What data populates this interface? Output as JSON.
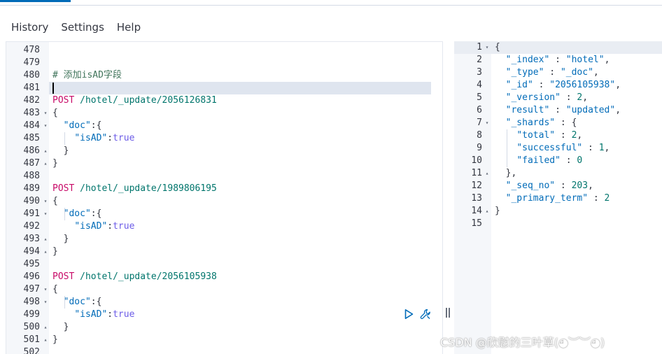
{
  "menu": {
    "items": [
      "History",
      "Settings",
      "Help"
    ]
  },
  "request_editor": {
    "lines": [
      {
        "num": "478",
        "fold": "",
        "tokens": []
      },
      {
        "num": "479",
        "fold": "",
        "tokens": []
      },
      {
        "num": "480",
        "fold": "",
        "tokens": [
          {
            "t": "comment",
            "v": "# 添加isAD字段"
          }
        ]
      },
      {
        "num": "481",
        "fold": "",
        "tokens": [],
        "active": true
      },
      {
        "num": "482",
        "fold": "",
        "tokens": [
          {
            "t": "method",
            "v": "POST"
          },
          {
            "t": "punc",
            "v": " "
          },
          {
            "t": "url",
            "v": "/hotel/_update/2056126831"
          }
        ]
      },
      {
        "num": "483",
        "fold": "▾",
        "tokens": [
          {
            "t": "punc",
            "v": "{"
          }
        ]
      },
      {
        "num": "484",
        "fold": "▾",
        "tokens": [
          {
            "t": "punc",
            "v": "  "
          },
          {
            "t": "key",
            "v": "\"doc\""
          },
          {
            "t": "punc",
            "v": ":{"
          }
        ]
      },
      {
        "num": "485",
        "fold": "",
        "tokens": [
          {
            "t": "punc",
            "v": "    "
          },
          {
            "t": "key",
            "v": "\"isAD\""
          },
          {
            "t": "punc",
            "v": ":"
          },
          {
            "t": "bool",
            "v": "true"
          }
        ]
      },
      {
        "num": "486",
        "fold": "▴",
        "tokens": [
          {
            "t": "punc",
            "v": "  }"
          }
        ]
      },
      {
        "num": "487",
        "fold": "▴",
        "tokens": [
          {
            "t": "punc",
            "v": "}"
          }
        ]
      },
      {
        "num": "488",
        "fold": "",
        "tokens": []
      },
      {
        "num": "489",
        "fold": "",
        "tokens": [
          {
            "t": "method",
            "v": "POST"
          },
          {
            "t": "punc",
            "v": " "
          },
          {
            "t": "url",
            "v": "/hotel/_update/1989806195"
          }
        ]
      },
      {
        "num": "490",
        "fold": "▾",
        "tokens": [
          {
            "t": "punc",
            "v": "{"
          }
        ]
      },
      {
        "num": "491",
        "fold": "▾",
        "tokens": [
          {
            "t": "punc",
            "v": "  "
          },
          {
            "t": "key",
            "v": "\"doc\""
          },
          {
            "t": "punc",
            "v": ":{"
          }
        ]
      },
      {
        "num": "492",
        "fold": "",
        "tokens": [
          {
            "t": "punc",
            "v": "    "
          },
          {
            "t": "key",
            "v": "\"isAD\""
          },
          {
            "t": "punc",
            "v": ":"
          },
          {
            "t": "bool",
            "v": "true"
          }
        ]
      },
      {
        "num": "493",
        "fold": "▴",
        "tokens": [
          {
            "t": "punc",
            "v": "  }"
          }
        ]
      },
      {
        "num": "494",
        "fold": "▴",
        "tokens": [
          {
            "t": "punc",
            "v": "}"
          }
        ]
      },
      {
        "num": "495",
        "fold": "",
        "tokens": []
      },
      {
        "num": "496",
        "fold": "",
        "tokens": [
          {
            "t": "method",
            "v": "POST"
          },
          {
            "t": "punc",
            "v": " "
          },
          {
            "t": "url",
            "v": "/hotel/_update/2056105938"
          }
        ]
      },
      {
        "num": "497",
        "fold": "▾",
        "tokens": [
          {
            "t": "punc",
            "v": "{"
          }
        ]
      },
      {
        "num": "498",
        "fold": "▾",
        "tokens": [
          {
            "t": "punc",
            "v": "  "
          },
          {
            "t": "key",
            "v": "\"doc\""
          },
          {
            "t": "punc",
            "v": ":{"
          }
        ]
      },
      {
        "num": "499",
        "fold": "",
        "tokens": [
          {
            "t": "punc",
            "v": "    "
          },
          {
            "t": "key",
            "v": "\"isAD\""
          },
          {
            "t": "punc",
            "v": ":"
          },
          {
            "t": "bool",
            "v": "true"
          }
        ]
      },
      {
        "num": "500",
        "fold": "▴",
        "tokens": [
          {
            "t": "punc",
            "v": "  }"
          }
        ]
      },
      {
        "num": "501",
        "fold": "▴",
        "tokens": [
          {
            "t": "punc",
            "v": "}"
          }
        ]
      },
      {
        "num": "502",
        "fold": "",
        "tokens": []
      }
    ]
  },
  "response_editor": {
    "lines": [
      {
        "num": "1",
        "fold": "▾",
        "tokens": [
          {
            "t": "punc",
            "v": "{"
          }
        ]
      },
      {
        "num": "2",
        "fold": "",
        "tokens": [
          {
            "t": "punc",
            "v": "  "
          },
          {
            "t": "str",
            "v": "\"_index\""
          },
          {
            "t": "punc",
            "v": " : "
          },
          {
            "t": "str",
            "v": "\"hotel\""
          },
          {
            "t": "punc",
            "v": ","
          }
        ]
      },
      {
        "num": "3",
        "fold": "",
        "tokens": [
          {
            "t": "punc",
            "v": "  "
          },
          {
            "t": "str",
            "v": "\"_type\""
          },
          {
            "t": "punc",
            "v": " : "
          },
          {
            "t": "str",
            "v": "\"_doc\""
          },
          {
            "t": "punc",
            "v": ","
          }
        ]
      },
      {
        "num": "4",
        "fold": "",
        "tokens": [
          {
            "t": "punc",
            "v": "  "
          },
          {
            "t": "str",
            "v": "\"_id\""
          },
          {
            "t": "punc",
            "v": " : "
          },
          {
            "t": "str",
            "v": "\"2056105938\""
          },
          {
            "t": "punc",
            "v": ","
          }
        ]
      },
      {
        "num": "5",
        "fold": "",
        "tokens": [
          {
            "t": "punc",
            "v": "  "
          },
          {
            "t": "str",
            "v": "\"_version\""
          },
          {
            "t": "punc",
            "v": " : "
          },
          {
            "t": "num",
            "v": "2"
          },
          {
            "t": "punc",
            "v": ","
          }
        ]
      },
      {
        "num": "6",
        "fold": "",
        "tokens": [
          {
            "t": "punc",
            "v": "  "
          },
          {
            "t": "str",
            "v": "\"result\""
          },
          {
            "t": "punc",
            "v": " : "
          },
          {
            "t": "str",
            "v": "\"updated\""
          },
          {
            "t": "punc",
            "v": ","
          }
        ]
      },
      {
        "num": "7",
        "fold": "▾",
        "tokens": [
          {
            "t": "punc",
            "v": "  "
          },
          {
            "t": "str",
            "v": "\"_shards\""
          },
          {
            "t": "punc",
            "v": " : {"
          }
        ]
      },
      {
        "num": "8",
        "fold": "",
        "tokens": [
          {
            "t": "punc",
            "v": "    "
          },
          {
            "t": "str",
            "v": "\"total\""
          },
          {
            "t": "punc",
            "v": " : "
          },
          {
            "t": "num",
            "v": "2"
          },
          {
            "t": "punc",
            "v": ","
          }
        ]
      },
      {
        "num": "9",
        "fold": "",
        "tokens": [
          {
            "t": "punc",
            "v": "    "
          },
          {
            "t": "str",
            "v": "\"successful\""
          },
          {
            "t": "punc",
            "v": " : "
          },
          {
            "t": "num",
            "v": "1"
          },
          {
            "t": "punc",
            "v": ","
          }
        ]
      },
      {
        "num": "10",
        "fold": "",
        "tokens": [
          {
            "t": "punc",
            "v": "    "
          },
          {
            "t": "str",
            "v": "\"failed\""
          },
          {
            "t": "punc",
            "v": " : "
          },
          {
            "t": "num",
            "v": "0"
          }
        ]
      },
      {
        "num": "11",
        "fold": "▴",
        "tokens": [
          {
            "t": "punc",
            "v": "  },"
          }
        ]
      },
      {
        "num": "12",
        "fold": "",
        "tokens": [
          {
            "t": "punc",
            "v": "  "
          },
          {
            "t": "str",
            "v": "\"_seq_no\""
          },
          {
            "t": "punc",
            "v": " : "
          },
          {
            "t": "num",
            "v": "203"
          },
          {
            "t": "punc",
            "v": ","
          }
        ]
      },
      {
        "num": "13",
        "fold": "",
        "tokens": [
          {
            "t": "punc",
            "v": "  "
          },
          {
            "t": "str",
            "v": "\"_primary_term\""
          },
          {
            "t": "punc",
            "v": " : "
          },
          {
            "t": "num",
            "v": "2"
          }
        ]
      },
      {
        "num": "14",
        "fold": "▴",
        "tokens": [
          {
            "t": "punc",
            "v": "}"
          }
        ]
      },
      {
        "num": "15",
        "fold": "",
        "tokens": []
      }
    ]
  },
  "actions": {
    "run_icon": "play-icon",
    "settings_icon": "wrench-icon"
  },
  "watermark": "CSDN @欣慰的三叶草(◕︶︶◕)",
  "colors": {
    "accent": "#006bb8",
    "method": "#c80a68",
    "url": "#00756c",
    "key": "#006bb8",
    "bool": "#6c5ce7",
    "comment": "#41755c"
  }
}
